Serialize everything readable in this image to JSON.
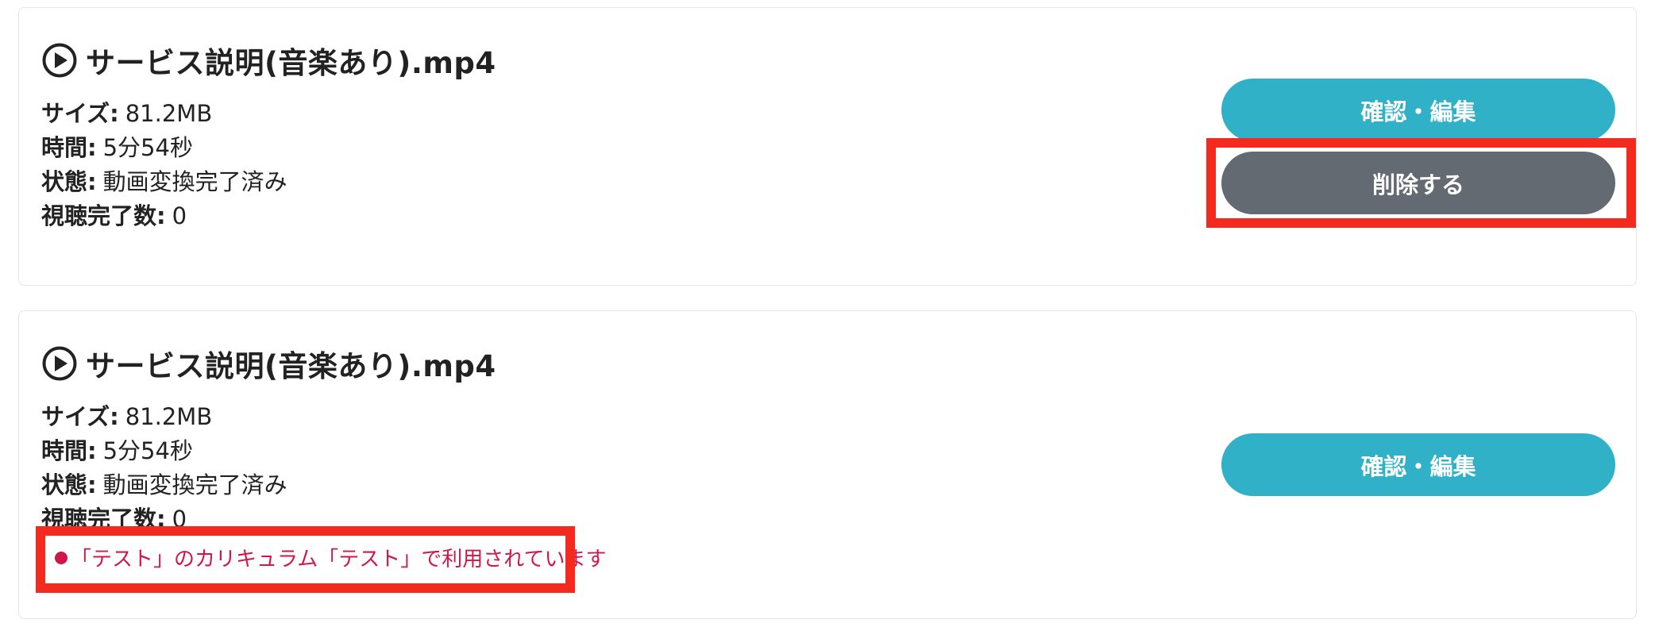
{
  "videos": [
    {
      "title": "サービス説明(音楽あり).mp4",
      "fields": [
        {
          "label": "サイズ:",
          "value": "81.2MB"
        },
        {
          "label": "時間:",
          "value": "5分54秒"
        },
        {
          "label": "状態:",
          "value": "動画変換完了済み"
        },
        {
          "label": "視聴完了数:",
          "value": "0"
        }
      ],
      "edit_label": "確認・編集",
      "delete_label": "削除する"
    },
    {
      "title": "サービス説明(音楽あり).mp4",
      "fields": [
        {
          "label": "サイズ:",
          "value": "81.2MB"
        },
        {
          "label": "時間:",
          "value": "5分54秒"
        },
        {
          "label": "状態:",
          "value": "動画変換完了済み"
        },
        {
          "label": "視聴完了数:",
          "value": "0"
        }
      ],
      "edit_label": "確認・編集",
      "usage_notice": "「テスト」のカリキュラム「テスト」で利用されています"
    }
  ],
  "colors": {
    "edit_button": "#31b1c7",
    "delete_button": "#646a71",
    "notice_text": "#d0174a",
    "highlight_box": "#f52a1e"
  },
  "icons": {
    "title": "play-circle-icon",
    "notice": "bullet-dot-icon"
  }
}
